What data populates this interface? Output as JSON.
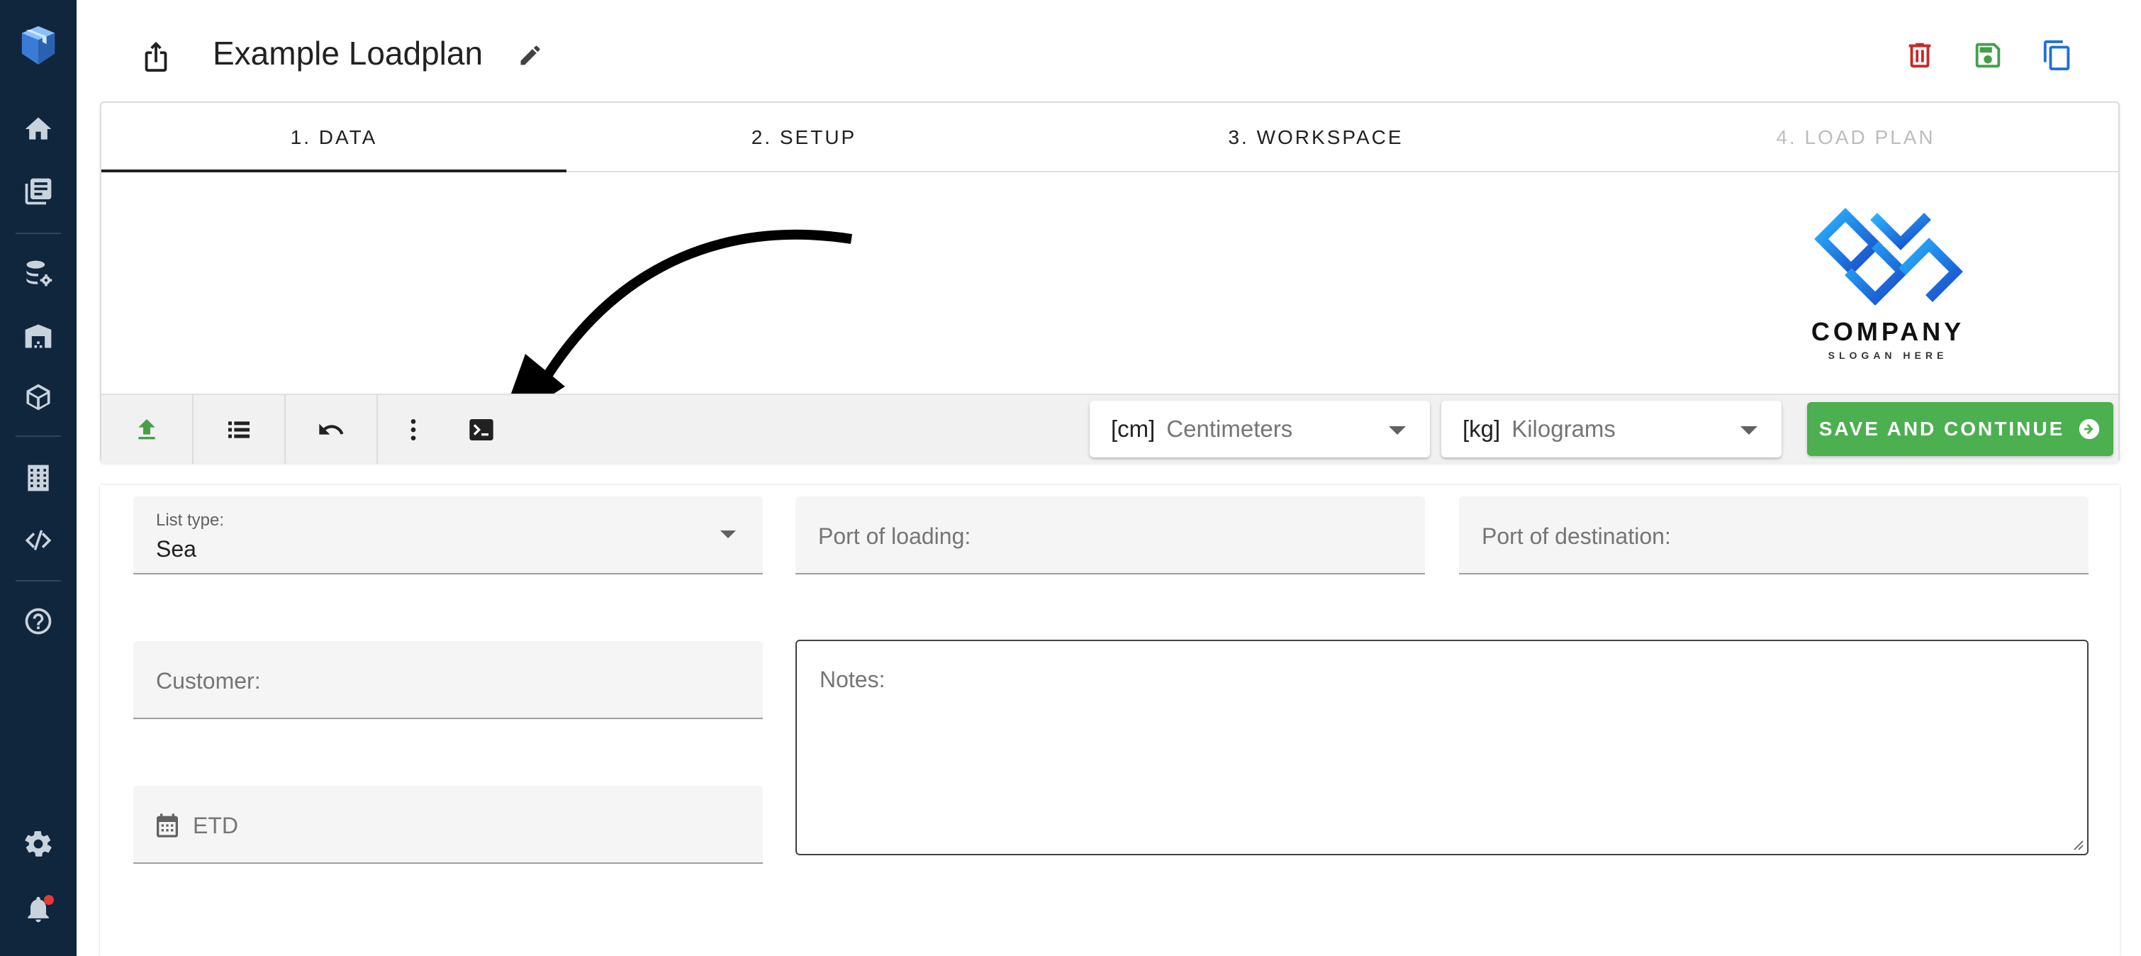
{
  "header": {
    "title": "Example Loadplan"
  },
  "tabs": [
    {
      "label": "1. DATA",
      "active": true,
      "disabled": false
    },
    {
      "label": "2. SETUP",
      "active": false,
      "disabled": false
    },
    {
      "label": "3. WORKSPACE",
      "active": false,
      "disabled": false
    },
    {
      "label": "4. LOAD PLAN",
      "active": false,
      "disabled": true
    }
  ],
  "logo": {
    "word": "COMPANY",
    "slogan": "SLOGAN HERE"
  },
  "toolbar": {
    "length_unit": {
      "abbr": "[cm]",
      "name": "Centimeters"
    },
    "weight_unit": {
      "abbr": "[kg]",
      "name": "Kilograms"
    },
    "save_label": "SAVE AND CONTINUE"
  },
  "form": {
    "list_type": {
      "label": "List type:",
      "value": "Sea"
    },
    "port_loading": {
      "placeholder": "Port of loading:"
    },
    "port_destination": {
      "placeholder": "Port of destination:"
    },
    "customer": {
      "placeholder": "Customer:"
    },
    "notes": {
      "placeholder": "Notes:"
    },
    "etd": {
      "placeholder": "ETD"
    }
  },
  "colors": {
    "sidebar": "#10263d",
    "accent_green": "#4caf50",
    "delete_red": "#c62828",
    "copy_blue": "#1e6fd9"
  },
  "icons": {
    "sidebar": [
      "app-logo-icon",
      "home-icon",
      "documents-icon",
      "database-settings-icon",
      "warehouse-icon",
      "package-icon",
      "building-icon",
      "code-icon",
      "help-icon",
      "settings-icon",
      "bell-icon"
    ],
    "header": [
      "share-icon",
      "edit-pencil-icon",
      "delete-icon",
      "save-icon",
      "copy-icon"
    ],
    "toolbar": [
      "upload-icon",
      "list-icon",
      "undo-icon",
      "more-vertical-icon",
      "console-icon",
      "arrow-circle-right-icon"
    ]
  }
}
